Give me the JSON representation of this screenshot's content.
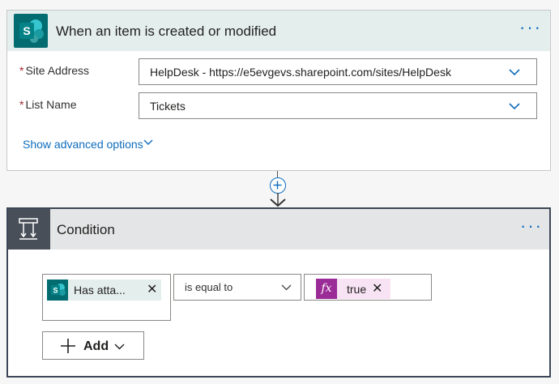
{
  "trigger": {
    "title": "When an item is created or modified",
    "more": "···",
    "site_address_label": "Site Address",
    "site_address_value": "HelpDesk - https://e5evgevs.sharepoint.com/sites/HelpDesk",
    "list_name_label": "List Name",
    "list_name_value": "Tickets",
    "required_mark": "*",
    "advanced_link": "Show advanced options",
    "icon": "sharepoint-icon"
  },
  "connector": {
    "icon": "add-step-icon"
  },
  "condition": {
    "title": "Condition",
    "more": "···",
    "icon": "condition-icon",
    "left_token": "Has atta...",
    "operator": "is equal to",
    "right_token": "true",
    "right_token_icon": "fx",
    "add_label": "Add"
  },
  "colors": {
    "sharepoint": "#036c70",
    "accent": "#0f6cbd",
    "expression": "#9b2b96",
    "required": "#a4262c"
  }
}
